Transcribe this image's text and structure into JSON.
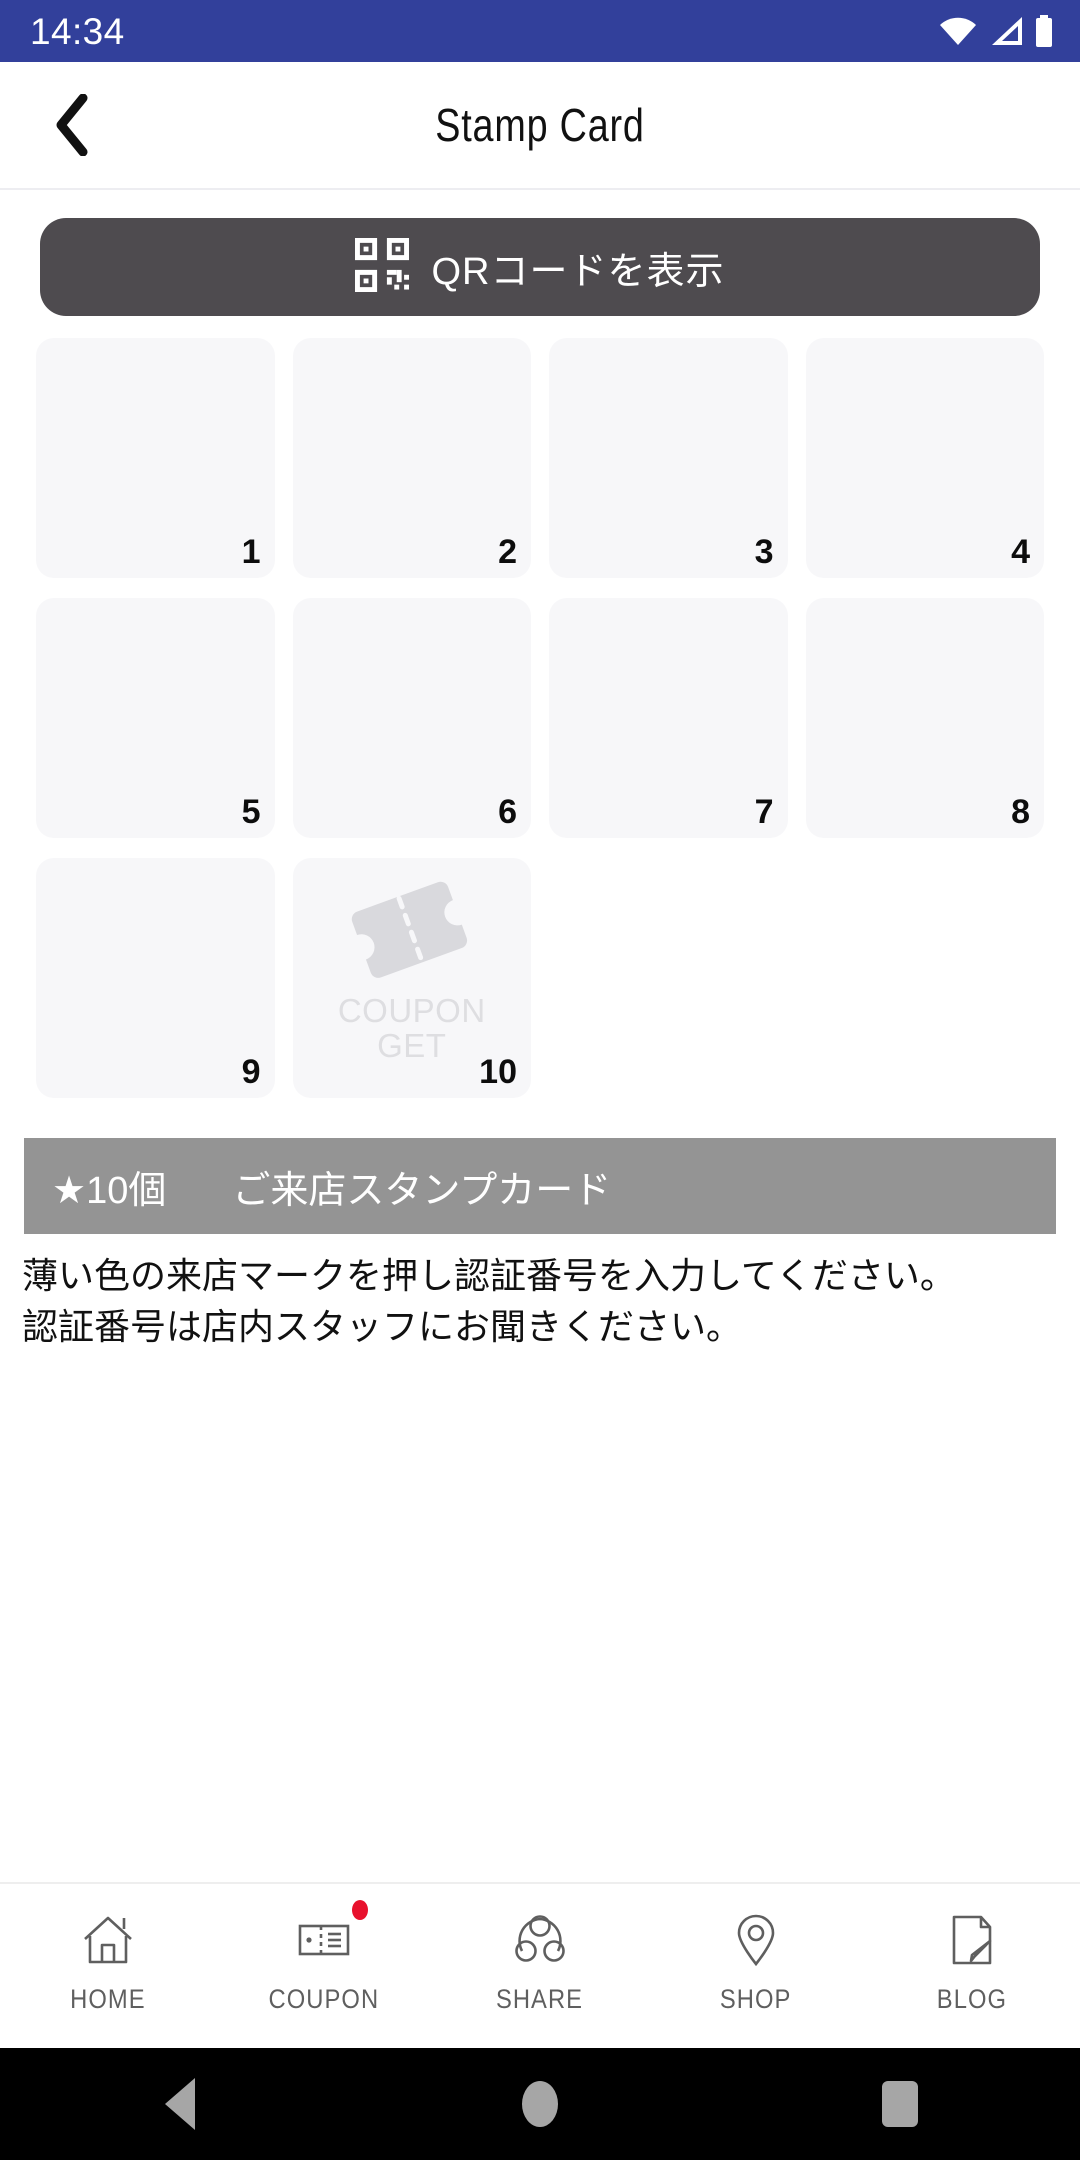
{
  "status_bar": {
    "time": "14:34",
    "background": "#32409b",
    "icons": [
      "wifi-icon",
      "cellular-signal-icon",
      "battery-icon"
    ]
  },
  "header": {
    "back_icon": "chevron-left-icon",
    "title": "Stamp Card"
  },
  "qr_button": {
    "label": "QRコードを表示",
    "icon": "qr-code-icon",
    "background": "#4e4b4f",
    "text_color": "#ffffff"
  },
  "stamp_card": {
    "total": 10,
    "collected": 0,
    "cell_color": "#f7f7f9",
    "cells": [
      {
        "number": "1",
        "state": "empty",
        "reward": false
      },
      {
        "number": "2",
        "state": "empty",
        "reward": false
      },
      {
        "number": "3",
        "state": "empty",
        "reward": false
      },
      {
        "number": "4",
        "state": "empty",
        "reward": false
      },
      {
        "number": "5",
        "state": "empty",
        "reward": false
      },
      {
        "number": "6",
        "state": "empty",
        "reward": false
      },
      {
        "number": "7",
        "state": "empty",
        "reward": false
      },
      {
        "number": "8",
        "state": "empty",
        "reward": false
      },
      {
        "number": "9",
        "state": "empty",
        "reward": false
      },
      {
        "number": "10",
        "state": "empty",
        "reward": true,
        "reward_icon": "coupon-ticket-icon",
        "reward_line1": "COUPON",
        "reward_line2": "GET"
      }
    ]
  },
  "banner": {
    "count_label": "★10個",
    "title": "ご来店スタンプカード",
    "background": "#949494",
    "text_color": "#ffffff"
  },
  "instructions": {
    "line1": "薄い色の来店マークを押し認証番号を入力してください。",
    "line2": "認証番号は店内スタッフにお聞きください。"
  },
  "bottom_nav": {
    "items": [
      {
        "label": "HOME",
        "icon": "home-icon",
        "badge": false
      },
      {
        "label": "COUPON",
        "icon": "coupon-icon",
        "badge": true,
        "badge_color": "#e8112d"
      },
      {
        "label": "SHARE",
        "icon": "share-icon",
        "badge": false
      },
      {
        "label": "SHOP",
        "icon": "map-pin-icon",
        "badge": false
      },
      {
        "label": "BLOG",
        "icon": "blog-icon",
        "badge": false
      }
    ]
  },
  "system_nav": {
    "back": "android-back-button",
    "home": "android-home-button",
    "recents": "android-recents-button"
  }
}
